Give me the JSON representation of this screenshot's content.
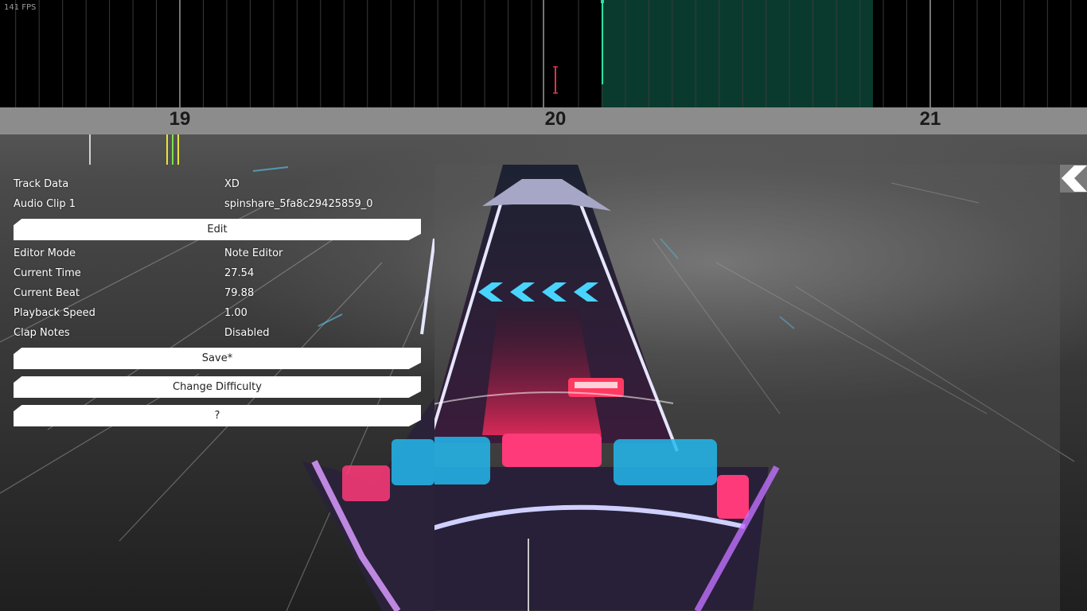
{
  "timeline": {
    "fps_label": "141 FPS",
    "beat_labels": [
      "19",
      "20",
      "21"
    ]
  },
  "panel": {
    "rows": [
      {
        "key": "Track Data",
        "value": "XD"
      },
      {
        "key": "Audio Clip 1",
        "value": "spinshare_5fa8c29425859_0"
      }
    ],
    "edit_button": "Edit",
    "status_rows": [
      {
        "key": "Editor Mode",
        "value": "Note Editor"
      },
      {
        "key": "Current Time",
        "value": "27.54"
      },
      {
        "key": "Current Beat",
        "value": "79.88"
      },
      {
        "key": "Playback Speed",
        "value": "1.00"
      },
      {
        "key": "Clap Notes",
        "value": "Disabled"
      }
    ],
    "save_button": "Save*",
    "change_difficulty_button": "Change Difficulty",
    "help_button": "?"
  },
  "icons": {
    "back": "chevron-left-icon"
  },
  "colors": {
    "selection": "#0a3a2e",
    "playhead": "#2de0a5",
    "note_red": "#e0304f",
    "note_cyan": "#2cc8ff",
    "marker_yellow": "#e8e23a",
    "marker_green": "#7ee04a"
  }
}
